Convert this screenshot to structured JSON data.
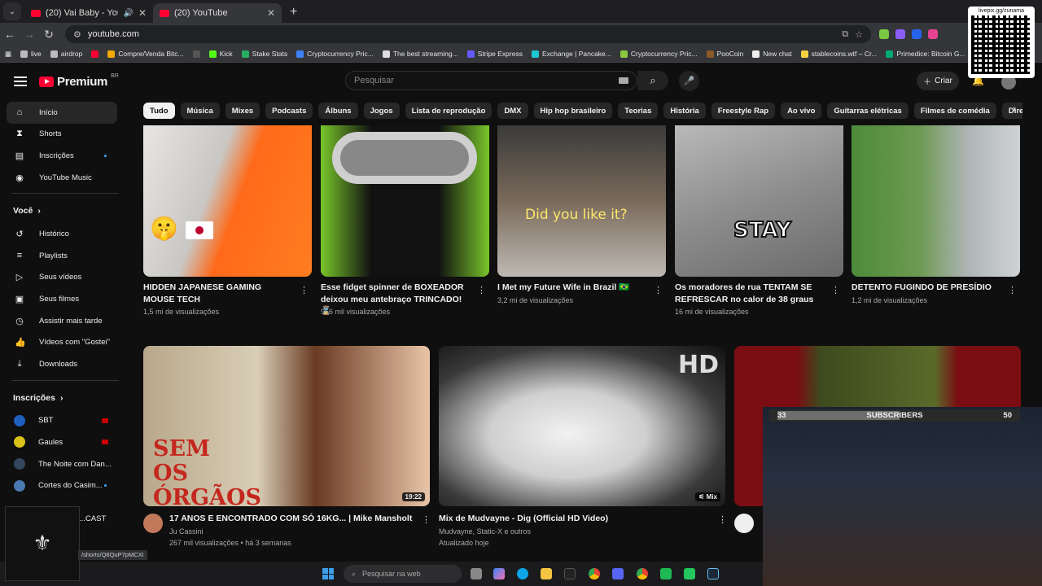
{
  "browser": {
    "tabs": [
      {
        "title": "(20) Vai Baby - YouTube",
        "active": false
      },
      {
        "title": "(20) YouTube",
        "active": true
      }
    ],
    "url": "youtube.com",
    "bookmarks": [
      "live",
      "airdrop",
      "Compre/Venda Bitc...",
      "Kick",
      "Stake Stats",
      "Cryptocurrency Pric...",
      "The best streaming...",
      "Stripe Express",
      "Exchange | Pancake...",
      "Cryptocurrency Pric...",
      "PooCoin",
      "New chat",
      "stablecoins.wtf – Cr...",
      "Primedice: Bitcoin G..."
    ]
  },
  "qr": {
    "caption": "livepix.gg/zunama"
  },
  "header": {
    "logo": "Premium",
    "country": "BR",
    "search_placeholder": "Pesquisar",
    "create_label": "Criar"
  },
  "sidebar": {
    "main": [
      {
        "label": "Início",
        "icon": "home-icon",
        "active": true
      },
      {
        "label": "Shorts",
        "icon": "shorts-icon"
      },
      {
        "label": "Inscrições",
        "icon": "subscriptions-icon",
        "dot": true
      },
      {
        "label": "YouTube Music",
        "icon": "music-icon"
      }
    ],
    "you_title": "Você",
    "you": [
      {
        "label": "Histórico",
        "icon": "history-icon"
      },
      {
        "label": "Playlists",
        "icon": "playlists-icon"
      },
      {
        "label": "Seus vídeos",
        "icon": "your-videos-icon"
      },
      {
        "label": "Seus filmes",
        "icon": "movies-icon"
      },
      {
        "label": "Assistir mais tarde",
        "icon": "watch-later-icon"
      },
      {
        "label": "Vídeos com \"Gostei\"",
        "icon": "like-icon"
      },
      {
        "label": "Downloads",
        "icon": "download-icon"
      }
    ],
    "subs_title": "Inscrições",
    "subs": [
      {
        "label": "SBT",
        "color": "#1f5fbf",
        "live": true
      },
      {
        "label": "Gaules",
        "color": "#d9c21a",
        "live": true
      },
      {
        "label": "The Noite com Dan...",
        "color": "#33475e"
      },
      {
        "label": "Cortes do Casim...",
        "color": "#4a78b0",
        "dot": true
      },
      {
        "label": "...CAST",
        "color": "#555"
      }
    ]
  },
  "chips": [
    "Tudo",
    "Música",
    "Mixes",
    "Podcasts",
    "Álbuns",
    "Jogos",
    "Lista de reprodução",
    "DMX",
    "Hip hop brasileiro",
    "Teorias",
    "História",
    "Freestyle Rap",
    "Ao vivo",
    "Guitarras elétricas",
    "Filmes de comédia",
    "Direção"
  ],
  "row1": [
    {
      "title": "HIDDEN JAPANESE GAMING MOUSE TECH",
      "meta": "1,5 mi de visualizações"
    },
    {
      "title": "Esse fidget spinner de BOXEADOR deixou meu antebraço TRINCADO! ⌛",
      "meta": "966 mil visualizações"
    },
    {
      "title": "I Met my Future Wife in Brazil 🇧🇷",
      "meta": "3,2 mi de visualizações",
      "overlay": "Did you like it?"
    },
    {
      "title": "Os moradores de rua TENTAM SE REFRESCAR no calor de 38 graus",
      "meta": "16 mi de visualizações",
      "overlay": "STAY"
    },
    {
      "title": "DETENTO FUGINDO DE PRESÍDIO",
      "meta": "1,2 mi de visualizações"
    }
  ],
  "row2": [
    {
      "title": "17 ANOS E ENCONTRADO COM SÓ 16KG... | Mike Mansholt",
      "channel": "Ju Cassini",
      "meta": "267 mil visualizações • há 3 semanas",
      "duration": "19:22",
      "overlay": "SEM OS ÓRGÃOS"
    },
    {
      "title": "Mix de Mudvayne - Dig (Official HD Video)",
      "channel": "Mudvayne, Static-X e outros",
      "meta": "Atualizado hoje",
      "badge": "Mix",
      "overlay": "HD"
    }
  ],
  "overlay": {
    "subs_current": "33",
    "subs_label": "SUBSCRIBERS",
    "subs_goal": "50",
    "url_tip": "/shorts/Q8QuP7pMCXI"
  },
  "taskbar": {
    "search_placeholder": "Pesquisar na web"
  }
}
